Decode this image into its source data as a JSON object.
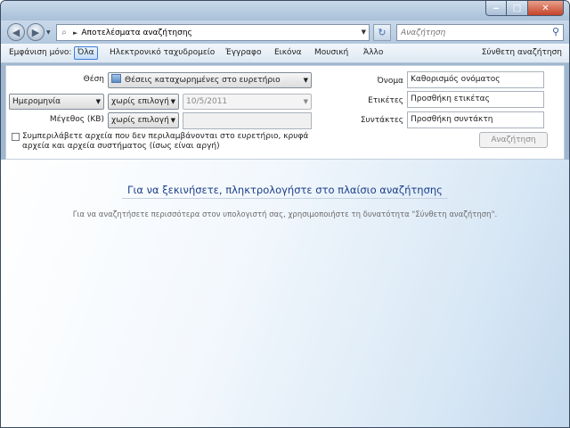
{
  "window": {
    "minimize_glyph": "‒",
    "maximize_glyph": "□",
    "close_glyph": "✕"
  },
  "address": {
    "path": "Αποτελέσματα αναζήτησης",
    "separator": "►",
    "search_placeholder": "Αναζήτηση"
  },
  "filter_bar": {
    "show_only_label": "Εμφάνιση μόνο:",
    "items": [
      "Όλα",
      "Ηλεκτρονικό ταχυδρομείο",
      "Έγγραφο",
      "Εικόνα",
      "Μουσική",
      "Άλλο"
    ],
    "selected": "Όλα",
    "advanced_search": "Σύνθετη αναζήτηση"
  },
  "advanced": {
    "location_label": "Θέση",
    "location_value": "Θέσεις καταχωρημένες στο ευρετήριο",
    "date_field": "Ημερομηνία",
    "date_operator": "χωρίς επιλογή",
    "date_value": "10/5/2011",
    "size_label": "Μέγεθος (KB)",
    "size_operator": "χωρίς επιλογή",
    "size_value": "",
    "name_label": "Όνομα",
    "name_value": "Καθορισμός ονόματος",
    "tags_label": "Ετικέτες",
    "tags_value": "Προσθήκη ετικέτας",
    "authors_label": "Συντάκτες",
    "authors_value": "Προσθήκη συντάκτη",
    "include_checkbox_label": "Συμπεριλάβετε αρχεία που δεν περιλαμβάνονται στο ευρετήριο, κρυφά αρχεία και αρχεία συστήματος (ίσως είναι αργή)",
    "search_button": "Αναζήτηση"
  },
  "main": {
    "headline": "Για να ξεκινήσετε, πληκτρολογήστε στο πλαίσιο αναζήτησης",
    "subtext": "Για να αναζητήσετε περισσότερα στον υπολογιστή σας, χρησιμοποιήστε τη δυνατότητα \"Σύνθετη αναζήτηση\"."
  },
  "colors": {
    "headline": "#1c3f8a",
    "selected_filter_border": "#3d7bd8"
  },
  "icons": [
    "back-arrow-icon",
    "forward-arrow-icon",
    "search-icon",
    "refresh-icon",
    "dropdown-arrow-icon",
    "indexed-folder-icon"
  ]
}
